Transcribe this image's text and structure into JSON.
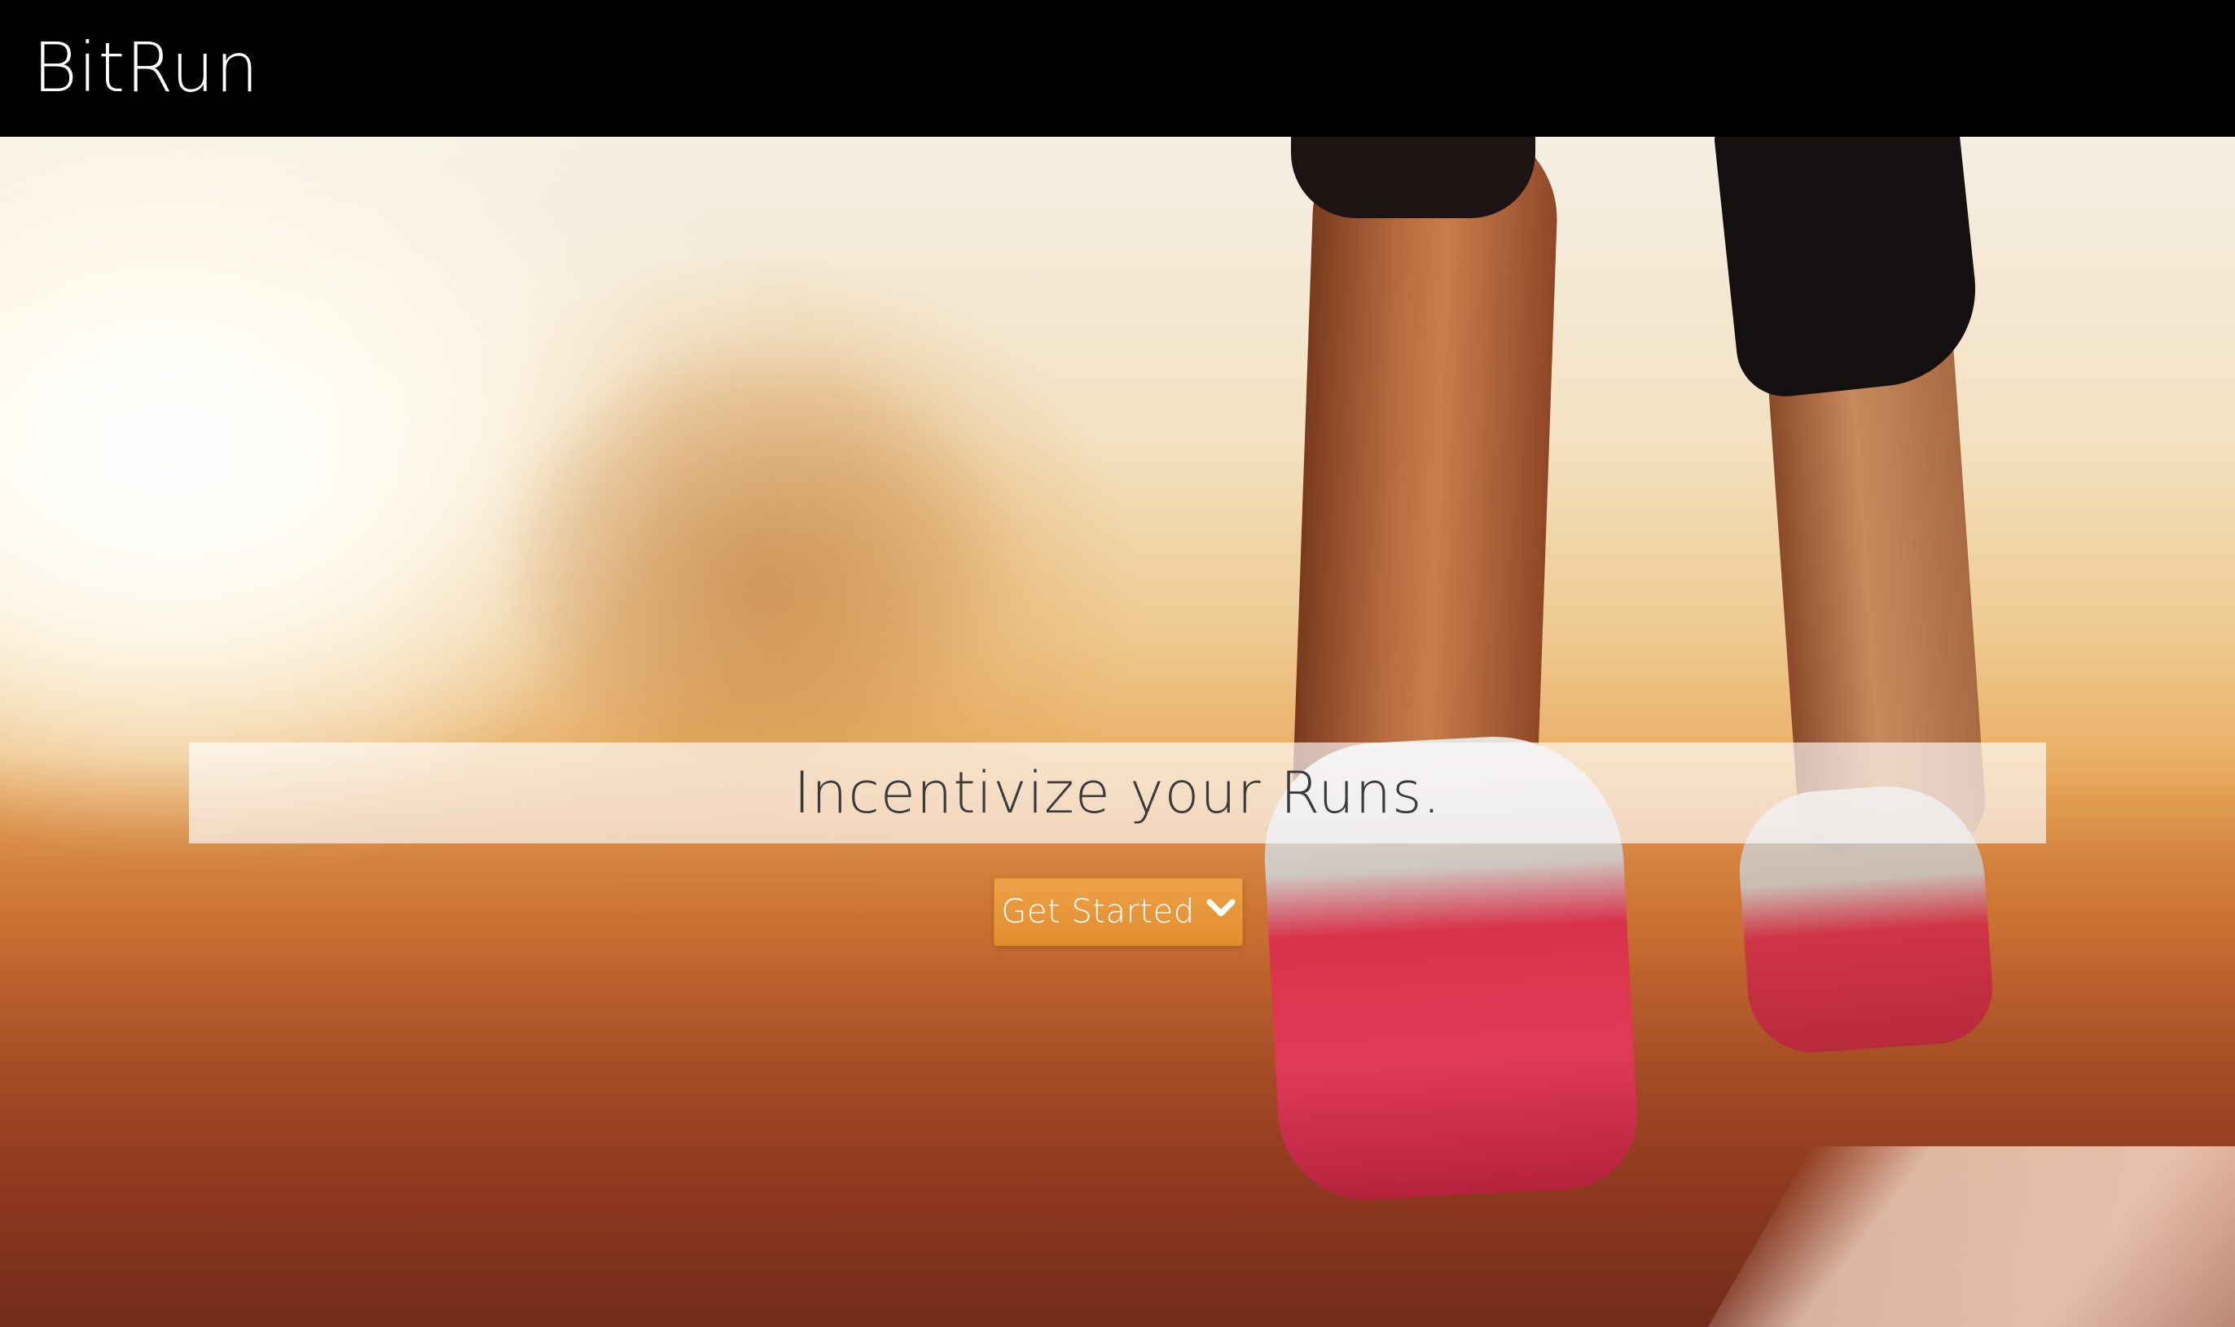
{
  "navbar": {
    "brand": "BitRun"
  },
  "hero": {
    "tagline": "Incentivize your Runs.",
    "cta_label": "Get Started",
    "cta_icon": "chevron-down-icon"
  },
  "colors": {
    "navbar_bg": "#000000",
    "brand_text": "#ffffff",
    "tagline_text": "#3a3a3a",
    "cta_bg": "#e8973a",
    "cta_text": "#ffffff"
  }
}
